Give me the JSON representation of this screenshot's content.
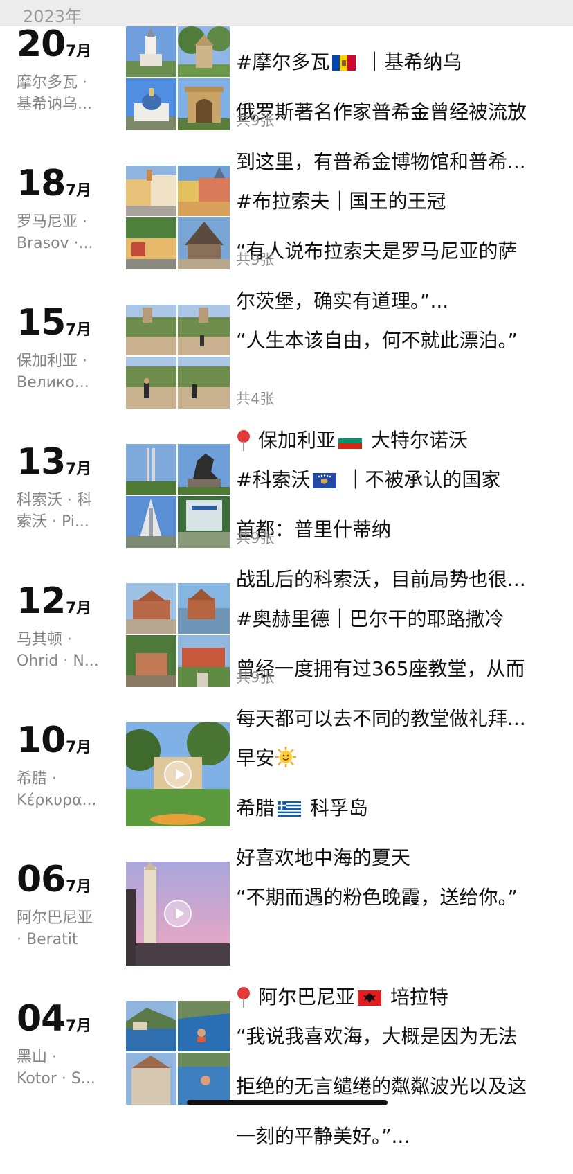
{
  "year_header": "2023年",
  "entries": [
    {
      "day": "20",
      "month": "7月",
      "location": "摩尔多瓦 ·\n基希讷乌...",
      "text_lines": [
        "#摩尔多瓦🇲🇩 ｜基希纳乌",
        "俄罗斯著名作家普希金曾经被流放",
        "到这里，有普希金博物馆和普希..."
      ],
      "photo_count": "共9张",
      "media": "grid"
    },
    {
      "day": "18",
      "month": "7月",
      "location": "罗马尼亚 ·\nBrasov ·...",
      "text_lines": [
        "#布拉索夫｜国王的王冠",
        "“有人说布拉索夫是罗马尼亚的萨",
        "尔茨堡，确实有道理。”..."
      ],
      "photo_count": "共9张",
      "media": "grid"
    },
    {
      "day": "15",
      "month": "7月",
      "location": "保加利亚 ·\nВелико...",
      "text_lines": [
        "“人生本该自由，何不就此漂泊。”",
        "",
        "📍 保加利亚🇧🇬 大特尔诺沃"
      ],
      "photo_count": "共4张",
      "media": "grid"
    },
    {
      "day": "13",
      "month": "7月",
      "location": "科索沃 · 科\n索沃 · Pi...",
      "text_lines": [
        "#科索沃🇽🇰 ｜不被承认的国家",
        "首都：普里什蒂纳",
        "战乱后的科索沃，目前局势也很..."
      ],
      "photo_count": "共9张",
      "media": "grid"
    },
    {
      "day": "12",
      "month": "7月",
      "location": "马其顿 ·\nOhrid · N...",
      "text_lines": [
        "#奥赫里德｜巴尔干的耶路撒冷",
        "曾经一度拥有过365座教堂，从而",
        "每天都可以去不同的教堂做礼拜..."
      ],
      "photo_count": "共9张",
      "media": "grid"
    },
    {
      "day": "10",
      "month": "7月",
      "location": "希腊 ·\nΚέρκυρα...",
      "text_lines": [
        "早安🌞",
        "希腊🇬🇷 科孚岛",
        "好喜欢地中海的夏天"
      ],
      "photo_count": "",
      "media": "video"
    },
    {
      "day": "06",
      "month": "7月",
      "location": "阿尔巴尼亚\n· Beratit",
      "text_lines": [
        "“不期而遇的粉色晚霞，送给你。”",
        "",
        "📍 阿尔巴尼亚🇦🇱 培拉特"
      ],
      "photo_count": "",
      "media": "video"
    },
    {
      "day": "04",
      "month": "7月",
      "location": "黑山 ·\nKotor · S...",
      "text_lines": [
        "“我说我喜欢海，大概是因为无法",
        "拒绝的无言缱绻的粼粼波光以及这",
        "一刻的平静美好。”..."
      ],
      "photo_count": "",
      "media": "grid"
    }
  ]
}
